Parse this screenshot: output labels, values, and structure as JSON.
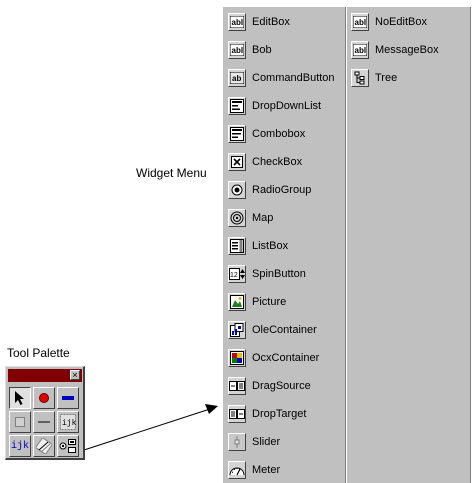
{
  "captions": {
    "widget_menu": "Widget Menu",
    "tool_palette": "Tool Palette"
  },
  "widget_menu": {
    "column1": [
      {
        "label": "EditBox",
        "icon": "editbox-icon"
      },
      {
        "label": "Bob",
        "icon": "bob-icon"
      },
      {
        "label": "CommandButton",
        "icon": "commandbutton-icon"
      },
      {
        "label": "DropDownList",
        "icon": "dropdownlist-icon"
      },
      {
        "label": "Combobox",
        "icon": "combobox-icon"
      },
      {
        "label": "CheckBox",
        "icon": "checkbox-icon"
      },
      {
        "label": "RadioGroup",
        "icon": "radiogroup-icon"
      },
      {
        "label": "Map",
        "icon": "map-icon"
      },
      {
        "label": "ListBox",
        "icon": "listbox-icon"
      },
      {
        "label": "SpinButton",
        "icon": "spinbutton-icon"
      },
      {
        "label": "Picture",
        "icon": "picture-icon"
      },
      {
        "label": "OleContainer",
        "icon": "olecontainer-icon"
      },
      {
        "label": "OcxContainer",
        "icon": "ocxcontainer-icon"
      },
      {
        "label": "DragSource",
        "icon": "dragsource-icon"
      },
      {
        "label": "DropTarget",
        "icon": "droptarget-icon"
      },
      {
        "label": "Slider",
        "icon": "slider-icon"
      },
      {
        "label": "Meter",
        "icon": "meter-icon"
      }
    ],
    "column2": [
      {
        "label": "NoEditBox",
        "icon": "noeditbox-icon"
      },
      {
        "label": "MessageBox",
        "icon": "messagebox-icon"
      },
      {
        "label": "Tree",
        "icon": "tree-icon"
      }
    ],
    "icon_text": {
      "ab": "ab",
      "abl": "abl",
      "spin": "12"
    }
  },
  "tool_palette": {
    "close_glyph": "×",
    "ijk_label": "ijk",
    "colors": {
      "title_bar": "#800000",
      "record_red": "#e00000",
      "stop_blue": "#0000c0"
    }
  }
}
